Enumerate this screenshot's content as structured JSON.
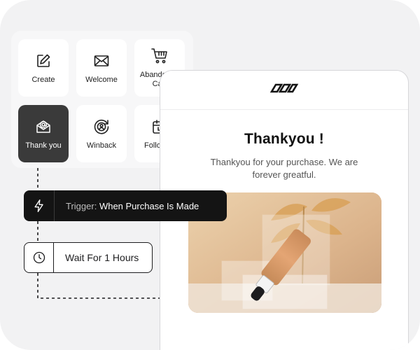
{
  "templates": [
    {
      "label": "Create",
      "icon": "edit-icon"
    },
    {
      "label": "Welcome",
      "icon": "envelope-icon"
    },
    {
      "label": "Abandoned Cart",
      "icon": "cart-icon"
    },
    {
      "label": "Thank you",
      "icon": "mail-at-icon",
      "active": true
    },
    {
      "label": "Winback",
      "icon": "winback-icon"
    },
    {
      "label": "Followup",
      "icon": "calendar-icon"
    }
  ],
  "trigger": {
    "prefix": "Trigger:",
    "value": "When Purchase Is Made",
    "icon": "bolt-icon"
  },
  "wait": {
    "label": "Wait For 1 Hours",
    "icon": "clock-icon"
  },
  "email": {
    "logo": "infinity-logo",
    "title": "Thankyou !",
    "body": "Thankyou for your purchase. We are forever greatful.",
    "hero": "serum-bottle-image"
  },
  "colors": {
    "dark": "#141414",
    "active_tile": "#3a3a3a",
    "canvas": "#f2f2f3",
    "hero": "#d9b08a"
  }
}
